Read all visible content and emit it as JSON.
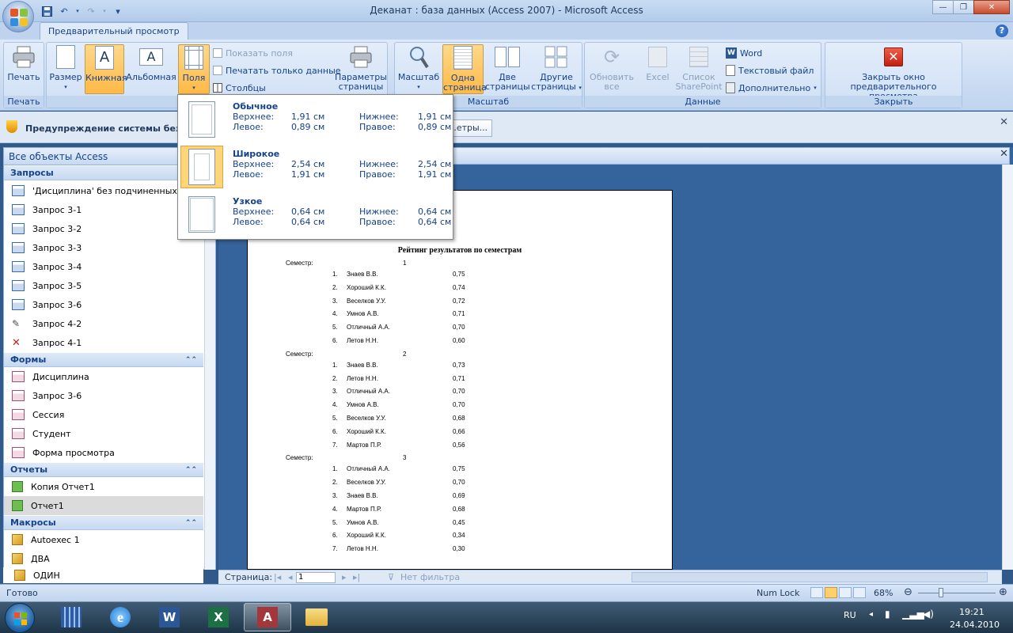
{
  "window": {
    "title": "Деканат : база данных (Access 2007) - Microsoft Access"
  },
  "ribbon": {
    "active_tab": "Предварительный просмотр",
    "print": {
      "label": "Печать",
      "group": "Печать"
    },
    "size": {
      "label": "Размер"
    },
    "portrait": {
      "label": "Книжная"
    },
    "landscape": {
      "label": "Альбомная"
    },
    "margins": {
      "label": "Поля"
    },
    "show_margins": "Показать поля",
    "print_data_only": "Печатать только данные",
    "columns": "Столбцы",
    "page_setup": {
      "line1": "Параметры",
      "line2": "страницы",
      "group": "Р"
    },
    "zoom": {
      "label": "Масштаб"
    },
    "one_page": {
      "line1": "Одна",
      "line2": "страница"
    },
    "two_pages": {
      "line1": "Две",
      "line2": "страницы"
    },
    "more_pages": {
      "line1": "Другие",
      "line2": "страницы"
    },
    "zoom_group": "Масштаб",
    "refresh_all": {
      "line1": "Обновить",
      "line2": "все"
    },
    "excel": "Excel",
    "sharepoint": {
      "line1": "Список",
      "line2": "SharePoint"
    },
    "word": "Word",
    "text_file": "Текстовый файл",
    "more": "Дополнительно",
    "data_group": "Данные",
    "close_preview": {
      "line1": "Закрыть окно",
      "line2": "предварительного просмотра"
    },
    "close_group": "Закрыть"
  },
  "margins_menu": [
    {
      "name": "Обычное",
      "top_label": "Верхнее:",
      "top": "1,91 см",
      "bottom_label": "Нижнее:",
      "bottom": "1,91 см",
      "left_label": "Левое:",
      "left": "0,89 см",
      "right_label": "Правое:",
      "right": "0,89 см"
    },
    {
      "name": "Широкое",
      "top_label": "Верхнее:",
      "top": "2,54 см",
      "bottom_label": "Нижнее:",
      "bottom": "2,54 см",
      "left_label": "Левое:",
      "left": "1,91 см",
      "right_label": "Правое:",
      "right": "1,91 см"
    },
    {
      "name": "Узкое",
      "top_label": "Верхнее:",
      "top": "0,64 см",
      "bottom_label": "Нижнее:",
      "bottom": "0,64 см",
      "left_label": "Левое:",
      "left": "0,64 см",
      "right_label": "Правое:",
      "right": "0,64 см"
    }
  ],
  "security": {
    "text": "Предупреждение системы безопасности",
    "button": "…етры..."
  },
  "nav": {
    "header": "Все объекты Access",
    "sections": {
      "queries": "Запросы",
      "forms": "Формы",
      "reports": "Отчеты",
      "macros": "Макросы"
    },
    "queries": [
      "'Дисциплина' без подчиненных в",
      "Запрос 3-1",
      "Запрос 3-2",
      "Запрос 3-3",
      "Запрос 3-4",
      "Запрос 3-5",
      "Запрос 3-6",
      "Запрос 4-2",
      "Запрос 4-1"
    ],
    "forms": [
      "Дисциплина",
      "Запрос 3-6",
      "Сессия",
      "Студент",
      "Форма просмотра"
    ],
    "reports": [
      "Копия Отчет1",
      "Отчет1"
    ],
    "macros": [
      "Autoexec 1",
      "ДВА",
      "ОДИН"
    ]
  },
  "report": {
    "title": "Рейтинг результатов по семестрам",
    "semester_label": "Семестр:",
    "semesters": [
      {
        "num": "1",
        "rows": [
          [
            "1.",
            "Знаев В.В.",
            "0,75"
          ],
          [
            "2.",
            "Хороший К.К.",
            "0,74"
          ],
          [
            "3.",
            "Веселков У.У.",
            "0,72"
          ],
          [
            "4.",
            "Умнов А.В.",
            "0,71"
          ],
          [
            "5.",
            "Отличный А.А.",
            "0,70"
          ],
          [
            "6.",
            "Летов Н.Н.",
            "0,60"
          ]
        ]
      },
      {
        "num": "2",
        "rows": [
          [
            "1.",
            "Знаев В.В.",
            "0,73"
          ],
          [
            "2.",
            "Летов Н.Н.",
            "0,71"
          ],
          [
            "3.",
            "Отличный А.А.",
            "0,70"
          ],
          [
            "4.",
            "Умнов А.В.",
            "0,70"
          ],
          [
            "5.",
            "Веселков У.У.",
            "0,68"
          ],
          [
            "6.",
            "Хороший К.К.",
            "0,66"
          ],
          [
            "7.",
            "Мартов П.Р.",
            "0,56"
          ]
        ]
      },
      {
        "num": "3",
        "rows": [
          [
            "1.",
            "Отличный А.А.",
            "0,75"
          ],
          [
            "2.",
            "Веселков У.У.",
            "0,70"
          ],
          [
            "3.",
            "Знаев В.В.",
            "0,69"
          ],
          [
            "4.",
            "Мартов П.Р.",
            "0,68"
          ],
          [
            "5.",
            "Умнов А.В.",
            "0,45"
          ],
          [
            "6.",
            "Хороший К.К.",
            "0,34"
          ],
          [
            "7.",
            "Летов Н.Н.",
            "0,30"
          ]
        ]
      }
    ]
  },
  "pager": {
    "label": "Страница:",
    "value": "1",
    "filter": "Нет фильтра"
  },
  "status": {
    "ready": "Готово",
    "numlock": "Num Lock",
    "zoom": "68%"
  },
  "tray": {
    "lang": "RU",
    "time": "19:21",
    "date": "24.04.2010"
  }
}
